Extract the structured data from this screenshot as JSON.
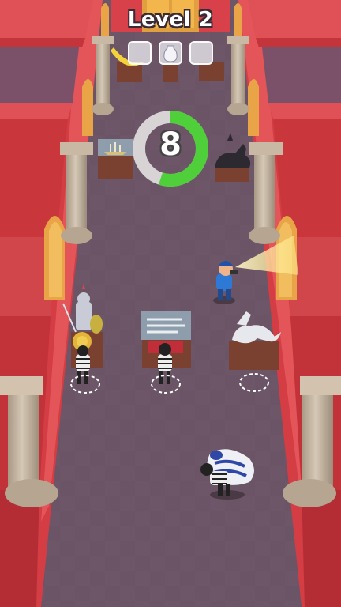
{
  "hud": {
    "level_label": "Level 2",
    "countdown": "8",
    "countdown_progress": 0.55,
    "loot_slots": [
      {
        "icon": "empty-slot-icon",
        "filled": false
      },
      {
        "icon": "vase-slot-icon",
        "filled": true
      },
      {
        "icon": "painting-slot-icon",
        "filled": false
      }
    ]
  },
  "colors": {
    "wall_red": "#e0474c",
    "floor": "#6e5768",
    "timer_green": "#4fcf3a",
    "timer_gray": "#d8d4d6",
    "pillar": "#cbbba8",
    "pedestal": "#7a4131",
    "flashlight": "#fff6b0"
  },
  "scene": {
    "exhibits": [
      {
        "name": "banana-exhibit"
      },
      {
        "name": "ship-model-exhibit"
      },
      {
        "name": "anubis-dog-statue-exhibit"
      },
      {
        "name": "knight-armor-exhibit"
      },
      {
        "name": "sword-display-case-exhibit"
      },
      {
        "name": "white-horse-statue-exhibit"
      }
    ],
    "characters": [
      {
        "name": "security-guard",
        "state": "patrolling-with-flashlight"
      },
      {
        "name": "thief-with-gold-coin"
      },
      {
        "name": "thief-with-red-frame"
      },
      {
        "name": "player-thief-carrying-vase"
      }
    ],
    "spawn_markers": 3
  }
}
